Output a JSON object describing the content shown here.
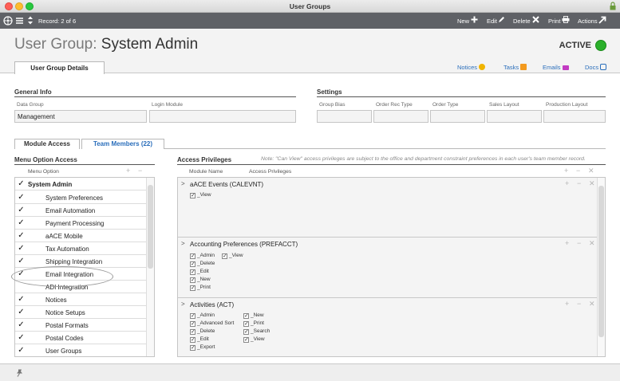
{
  "window": {
    "title": "User Groups"
  },
  "toolbar": {
    "record": "Record: 2 of 6",
    "new": "New",
    "edit": "Edit",
    "delete": "Delete",
    "print": "Print",
    "actions": "Actions"
  },
  "header": {
    "title_prefix": "User Group:",
    "title_name": "System Admin",
    "status": "ACTIVE",
    "status_color": "#2bb02b",
    "tab_details": "User Group Details",
    "links": {
      "notices": "Notices",
      "tasks": "Tasks",
      "emails": "Emails",
      "docs": "Docs"
    }
  },
  "general_info": {
    "heading": "General Info",
    "data_group_label": "Data Group",
    "data_group_value": "Management",
    "login_module_label": "Login Module",
    "login_module_value": ""
  },
  "settings": {
    "heading": "Settings",
    "fields": [
      "Group Bias",
      "Order Rec Type",
      "Order Type",
      "Sales Layout",
      "Production Layout"
    ]
  },
  "tabs": {
    "module_access": "Module Access",
    "team_members": "Team Members (22)"
  },
  "menu_access": {
    "heading": "Menu Option Access",
    "column": "Menu Option",
    "items": [
      {
        "label": "System Admin",
        "checked": "✓"
      },
      {
        "label": "System Preferences",
        "checked": "✓"
      },
      {
        "label": "Email Automation",
        "checked": "✓"
      },
      {
        "label": "Payment Processing",
        "checked": "✓"
      },
      {
        "label": "aACE Mobile",
        "checked": "✓"
      },
      {
        "label": "Tax Automation",
        "checked": "✓"
      },
      {
        "label": "Shipping Integration",
        "checked": "✓"
      },
      {
        "label": "Email Integration",
        "checked": "✓"
      },
      {
        "label": "ADI Integration",
        "checked": ""
      },
      {
        "label": "Notices",
        "checked": "✓"
      },
      {
        "label": "Notice Setups",
        "checked": "✓"
      },
      {
        "label": "Postal Formats",
        "checked": "✓"
      },
      {
        "label": "Postal Codes",
        "checked": "✓"
      },
      {
        "label": "User Groups",
        "checked": "✓"
      }
    ]
  },
  "access_privileges": {
    "heading": "Access Privileges",
    "note": "Note: \"Can View\" access privileges are subject to the office and department constraint preferences in each user's team member record.",
    "col_module": "Module Name",
    "col_privileges": "Access Privileges",
    "expand_glyph": ">",
    "modules": [
      {
        "title": "aACE Events  (CALEVNT)",
        "col1": [
          "_View"
        ],
        "col2": []
      },
      {
        "title": "Accounting Preferences  (PREFACCT)",
        "col1": [
          "_Admin",
          "_Delete",
          "_Edit",
          "_New",
          "_Print"
        ],
        "col2": [
          "_View"
        ]
      },
      {
        "title": "Activities  (ACT)",
        "col1": [
          "_Admin",
          "_Advanced Sort",
          "_Delete",
          "_Edit",
          "_Export"
        ],
        "col2": [
          "_New",
          "_Print",
          "_Search",
          "_View"
        ]
      }
    ]
  }
}
